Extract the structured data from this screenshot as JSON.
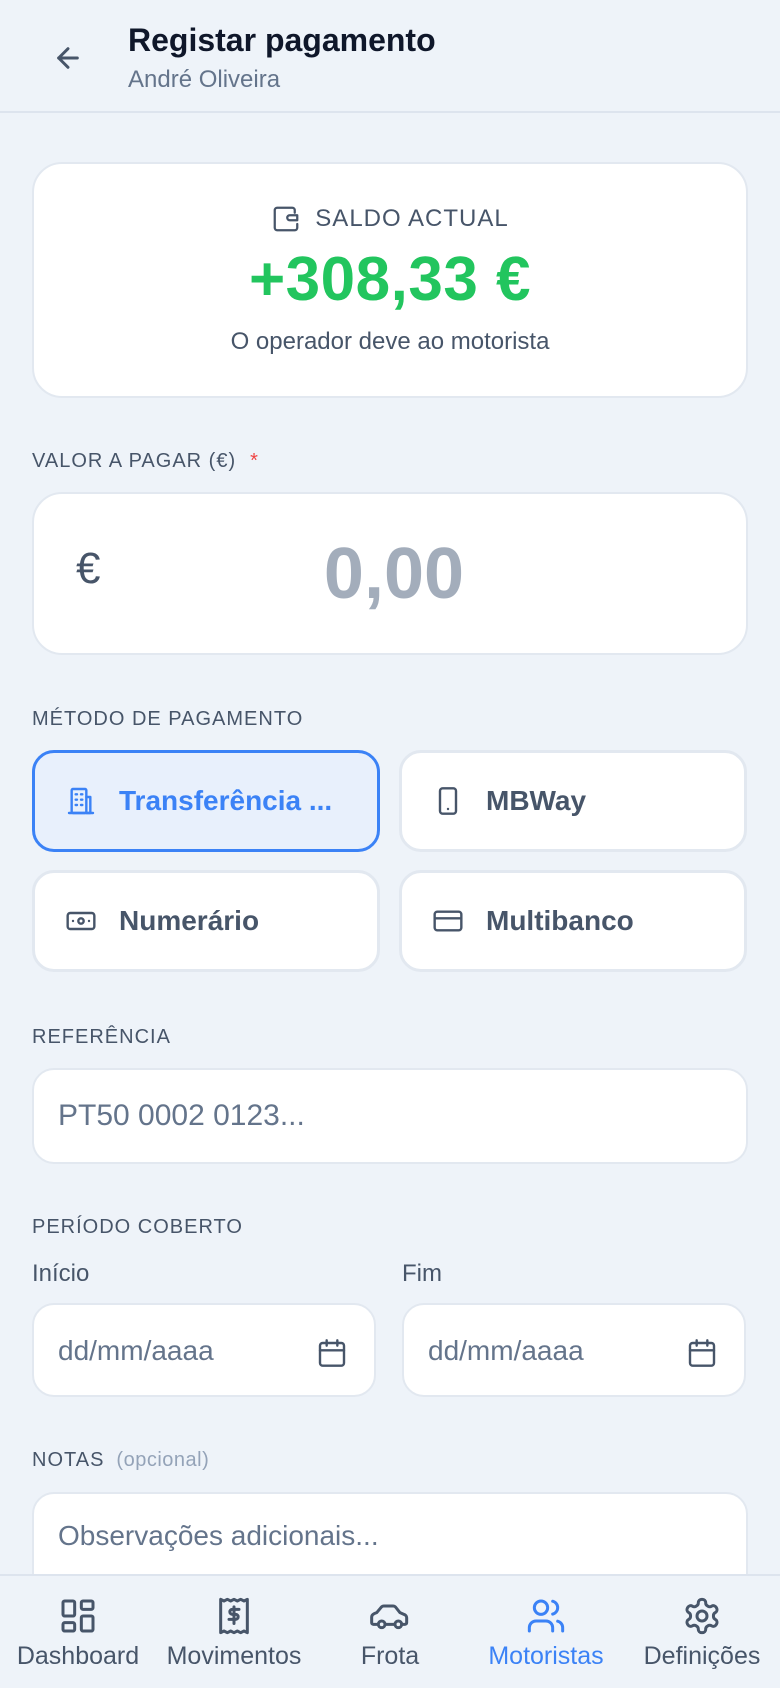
{
  "header": {
    "title": "Registar pagamento",
    "subtitle": "André Oliveira"
  },
  "balance": {
    "label": "SALDO ACTUAL",
    "amount": "+308,33 €",
    "note": "O operador deve ao motorista",
    "amount_color": "#22c55e"
  },
  "amount_section": {
    "label": "VALOR A PAGAR (€)",
    "required_mark": "*",
    "currency_symbol": "€",
    "placeholder": "0,00",
    "value": ""
  },
  "method_section": {
    "label": "MÉTODO DE PAGAMENTO",
    "selected": "transfer",
    "methods": [
      {
        "id": "transfer",
        "label": "Transferência ...",
        "icon": "building-icon"
      },
      {
        "id": "mbway",
        "label": "MBWay",
        "icon": "smartphone-icon"
      },
      {
        "id": "cash",
        "label": "Numerário",
        "icon": "banknote-icon"
      },
      {
        "id": "multibanco",
        "label": "Multibanco",
        "icon": "credit-card-icon"
      }
    ]
  },
  "reference_section": {
    "label": "REFERÊNCIA",
    "placeholder": "PT50 0002 0123...",
    "value": ""
  },
  "period_section": {
    "label": "PERÍODO COBERTO",
    "start_label": "Início",
    "start_placeholder": "dd/mm/aaaa",
    "end_label": "Fim",
    "end_placeholder": "dd/mm/aaaa"
  },
  "notes_section": {
    "label": "NOTAS",
    "optional": "(opcional)",
    "placeholder": "Observações adicionais...",
    "value": ""
  },
  "nav": {
    "active": "Motoristas",
    "items": [
      {
        "label": "Dashboard",
        "icon": "dashboard-icon"
      },
      {
        "label": "Movimentos",
        "icon": "receipt-icon"
      },
      {
        "label": "Frota",
        "icon": "car-icon"
      },
      {
        "label": "Motoristas",
        "icon": "users-icon"
      },
      {
        "label": "Definições",
        "icon": "gear-icon"
      }
    ]
  },
  "colors": {
    "accent": "#3b82f6",
    "positive": "#22c55e",
    "required": "#ef4444"
  }
}
